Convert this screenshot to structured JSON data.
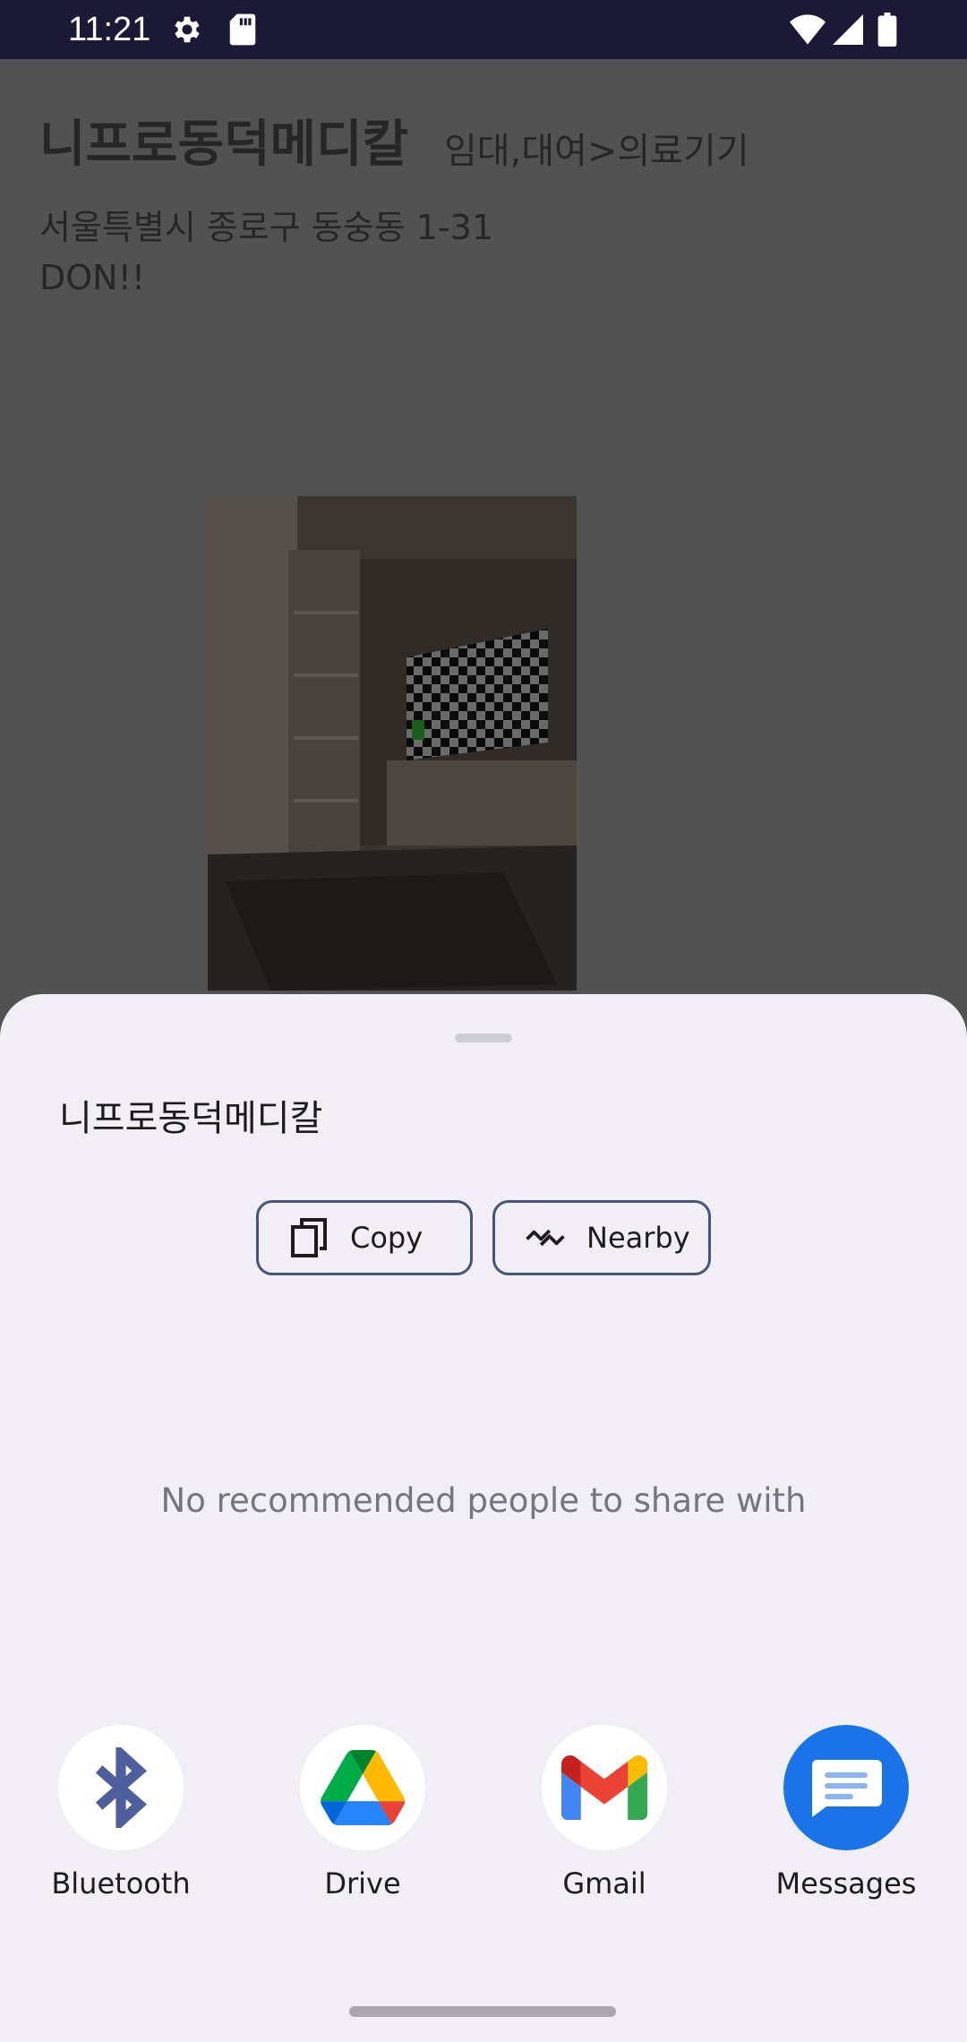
{
  "status_bar": {
    "time": "11:21",
    "icons": [
      "settings-icon",
      "sd-card-icon",
      "wifi-icon",
      "signal-icon",
      "battery-icon"
    ]
  },
  "place": {
    "name": "니프로동덕메디칼",
    "category": "임대,대여>의료기기",
    "address": "서울특별시 종로구 동숭동 1-31",
    "note": "DON!!"
  },
  "share_sheet": {
    "title": "니프로동덕메디칼",
    "actions": {
      "copy_label": "Copy",
      "nearby_label": "Nearby"
    },
    "empty_people_text": "No recommended people to share with",
    "targets": [
      {
        "label": "Bluetooth",
        "icon": "bluetooth-icon"
      },
      {
        "label": "Drive",
        "icon": "drive-icon"
      },
      {
        "label": "Gmail",
        "icon": "gmail-icon"
      },
      {
        "label": "Messages",
        "icon": "messages-icon"
      }
    ]
  },
  "colors": {
    "status_bar": "#1b1935",
    "scrim": "#525252",
    "sheet_background": "#f1eff5",
    "chip_border": "#46537a",
    "messages_blue": "#1a73e8",
    "bluetooth_blue": "#4d5f9c"
  }
}
